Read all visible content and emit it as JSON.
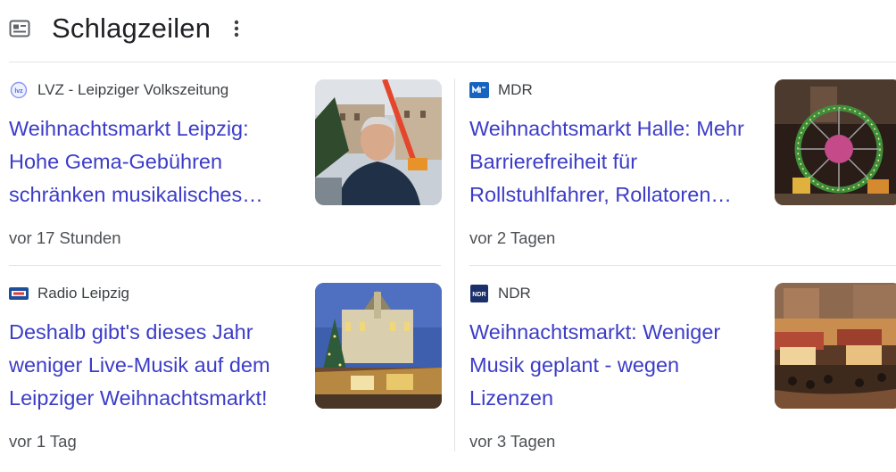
{
  "header": {
    "title": "Schlagzeilen"
  },
  "articles": [
    {
      "source": "LVZ - Leipziger Volkszeitung",
      "logo": "LVZ",
      "headline": "Weihnachtsmarkt Leipzig: Hohe Gema-Gebühren schränken musikalisches…",
      "time": "vor 17 Stunden"
    },
    {
      "source": "MDR",
      "logo": "MDR",
      "headline": "Weihnachtsmarkt Halle: Mehr Barrierefreiheit für Rollstuhlfahrer, Rollatoren…",
      "time": "vor 2 Tagen"
    },
    {
      "source": "Radio Leipzig",
      "logo": "Radio Leipzig",
      "headline": "Deshalb gibt's dieses Jahr weniger Live-Musik auf dem Leipziger Weihnachtsmarkt!",
      "time": "vor 1 Tag"
    },
    {
      "source": "NDR",
      "logo": "NDR",
      "headline": "Weihnachtsmarkt: Weniger Musik geplant - wegen Lizenzen",
      "time": "vor 3 Tagen"
    }
  ],
  "colors": {
    "link": "#3c3cc8",
    "text": "#202124",
    "meta": "#4d5156",
    "divider": "#e3e3e3"
  },
  "icons": {
    "header": "newspaper-icon",
    "menu": "more-vert-icon"
  }
}
